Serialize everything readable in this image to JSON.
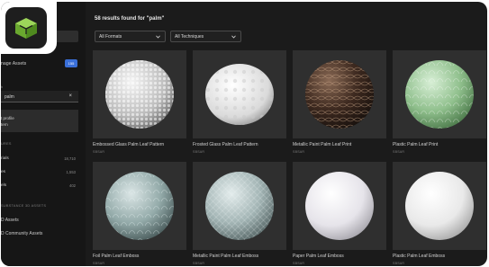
{
  "search": {
    "results_heading": "58 results found for \"palm\"",
    "query": "palm",
    "clear_icon": "close-icon"
  },
  "filters": {
    "format": "All Formats",
    "technique": "All Techniques"
  },
  "sidebar": {
    "manage_label": "nage Assets",
    "manage_badge": "155",
    "search_label": "h",
    "profile_line1": "t profile",
    "profile_line2": "tern",
    "section_types": "URES",
    "types": [
      {
        "label": "rials",
        "count": "18,710"
      },
      {
        "label": "es",
        "count": "1,553"
      },
      {
        "label": "els",
        "count": "402"
      }
    ],
    "section_sources": "SUBSTANCE 3D ASSETS",
    "sources": [
      {
        "label": "D Assets"
      },
      {
        "label": "D Community Assets"
      }
    ]
  },
  "results": [
    {
      "title": "Embossed Glass Palm Leaf Pattern",
      "tag": "SBSAR"
    },
    {
      "title": "Frosted Glass Palm Leaf Pattern",
      "tag": "SBSAR"
    },
    {
      "title": "Metallic Paint Palm Leaf Print",
      "tag": "SBSAR"
    },
    {
      "title": "Plastic Palm Leaf Print",
      "tag": "SBSAR"
    },
    {
      "title": "Foil Palm Leaf Emboss",
      "tag": "SBSAR"
    },
    {
      "title": "Metallic Paint Palm Leaf Emboss",
      "tag": "SBSAR"
    },
    {
      "title": "Paper Palm Leaf Emboss",
      "tag": "SBSAR"
    },
    {
      "title": "Plastic Palm Leaf Emboss",
      "tag": "SBSAR"
    }
  ],
  "colors": {
    "accent_blue": "#3a6fd8",
    "logo_green": "#7bc043",
    "background": "#1b1b1b"
  }
}
